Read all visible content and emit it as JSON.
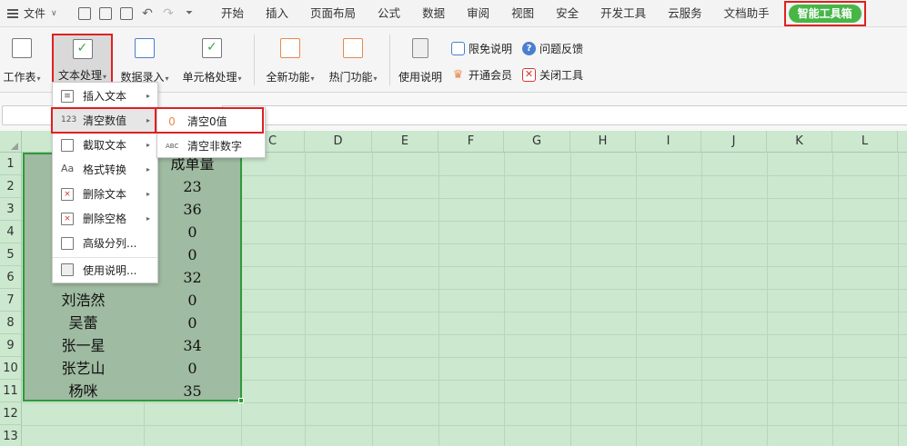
{
  "menubar": {
    "file_label": "文件",
    "tabs": [
      "开始",
      "插入",
      "页面布局",
      "公式",
      "数据",
      "审阅",
      "视图",
      "安全",
      "开发工具",
      "云服务",
      "文档助手"
    ],
    "active_tab": "智能工具箱",
    "accent_color": "#47b647",
    "highlight_color": "#e02020"
  },
  "ribbon": {
    "buttons": [
      {
        "label": "工作表",
        "icon": "worksheet-icon"
      },
      {
        "label": "文本处理",
        "icon": "text-process-icon"
      },
      {
        "label": "数据录入",
        "icon": "data-entry-icon"
      },
      {
        "label": "单元格处理",
        "icon": "cell-process-icon"
      },
      {
        "label": "全新功能",
        "icon": "new-feature-icon"
      },
      {
        "label": "热门功能",
        "icon": "hot-feature-icon"
      },
      {
        "label": "使用说明",
        "icon": "manual-icon"
      }
    ],
    "small": {
      "free_note": "限免说明",
      "feedback": "问题反馈",
      "vip": "开通会员",
      "close_tool": "关闭工具"
    }
  },
  "grid": {
    "columns": [
      "C",
      "D",
      "E",
      "F",
      "G",
      "H",
      "I",
      "J",
      "K",
      "L"
    ],
    "rows": [
      "1",
      "2",
      "3",
      "4",
      "5",
      "6",
      "7",
      "8",
      "9",
      "10",
      "11",
      "12",
      "13"
    ],
    "header_b1": "成单量",
    "names": [
      "",
      "",
      "",
      "",
      "",
      "",
      "刘浩然",
      "吴蕾",
      "张一星",
      "张艺山",
      "杨咪"
    ],
    "values": [
      "",
      "23",
      "36",
      "0",
      "0",
      "32",
      "0",
      "0",
      "34",
      "0",
      "35"
    ],
    "sheet_color": "#cce8cf",
    "selection_color": "#2e9a3a"
  },
  "dropdown": {
    "items": [
      {
        "label": "插入文本",
        "arrow": "▸"
      },
      {
        "label": "清空数值",
        "arrow": "▸",
        "icon_text": "123"
      },
      {
        "label": "截取文本",
        "arrow": "▸"
      },
      {
        "label": "格式转换",
        "arrow": "▸",
        "icon_text": "Aa"
      },
      {
        "label": "删除文本",
        "arrow": "▸"
      },
      {
        "label": "删除空格",
        "arrow": "▸"
      },
      {
        "label": "高级分列...",
        "arrow": ""
      },
      {
        "label": "使用说明...",
        "arrow": ""
      }
    ]
  },
  "submenu": {
    "items": [
      {
        "label": "清空0值",
        "icon_text": "0"
      },
      {
        "label": "清空非数字",
        "icon_text": "ABC"
      }
    ]
  }
}
